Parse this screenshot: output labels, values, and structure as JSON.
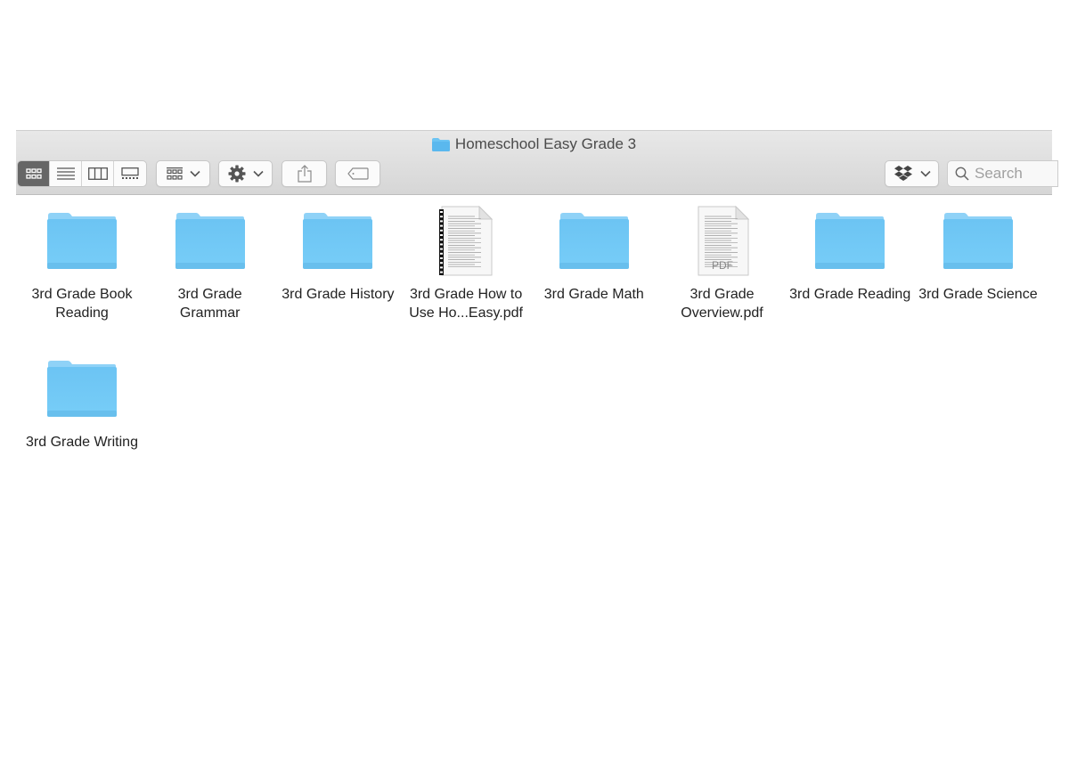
{
  "window": {
    "title": "Homeschool Easy Grade 3",
    "title_icon": "folder-icon"
  },
  "toolbar": {
    "view_modes": [
      {
        "name": "icon-view",
        "icon": "grid-icon",
        "active": true
      },
      {
        "name": "list-view",
        "icon": "list-icon",
        "active": false
      },
      {
        "name": "column-view",
        "icon": "columns-icon",
        "active": false
      },
      {
        "name": "gallery-view",
        "icon": "gallery-icon",
        "active": false
      }
    ],
    "group_button_icon": "group-grid-icon",
    "action_button_icon": "gear-icon",
    "share_button_icon": "share-icon",
    "tag_button_icon": "tag-icon",
    "dropbox_button_icon": "dropbox-icon",
    "search": {
      "placeholder": "Search",
      "value": ""
    }
  },
  "items": [
    {
      "name": "3rd Grade Book Reading",
      "type": "folder"
    },
    {
      "name": "3rd Grade Grammar",
      "type": "folder"
    },
    {
      "name": "3rd Grade History",
      "type": "folder"
    },
    {
      "name": "3rd Grade How to Use Ho...Easy.pdf",
      "type": "pdf-bound"
    },
    {
      "name": "3rd Grade Math",
      "type": "folder"
    },
    {
      "name": "3rd Grade Overview.pdf",
      "type": "pdf"
    },
    {
      "name": "3rd Grade Reading",
      "type": "folder"
    },
    {
      "name": "3rd Grade Science",
      "type": "folder"
    },
    {
      "name": "3rd Grade Writing",
      "type": "folder"
    }
  ],
  "colors": {
    "folder_blue": "#6cc4f3",
    "active_segment": "#666666"
  }
}
